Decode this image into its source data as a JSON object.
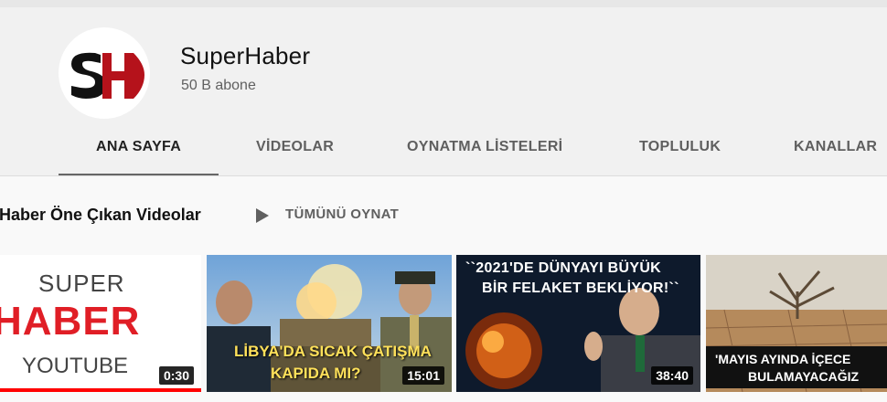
{
  "channel": {
    "name": "SuperHaber",
    "subscribers": "50 B abone",
    "avatar_letters": "SH",
    "brand_red": "#b5121b",
    "brand_black": "#111111"
  },
  "tabs": [
    {
      "label": "ANA SAYFA",
      "active": true
    },
    {
      "label": "VİDEOLAR",
      "active": false
    },
    {
      "label": "OYNATMA LİSTELERİ",
      "active": false
    },
    {
      "label": "TOPLULUK",
      "active": false
    },
    {
      "label": "KANALLAR",
      "active": false
    }
  ],
  "section": {
    "title": "rHaber Öne Çıkan Videolar",
    "play_all_label": "TÜMÜNÜ OYNAT",
    "play_icon": "play-icon"
  },
  "videos": [
    {
      "duration": "0:30",
      "thumb_lines": [
        "SUPER",
        "HABER",
        "YOUTUBE"
      ],
      "watched_fraction": 1.0
    },
    {
      "duration": "15:01",
      "thumb_lines": [
        "LİBYA'DA SICAK ÇATIŞMA",
        "KAPIDA MI?"
      ]
    },
    {
      "duration": "38:40",
      "thumb_lines": [
        "``2021'DE DÜNYAYI BÜYÜK",
        "BİR FELAKET BEKLİYOR!``"
      ]
    },
    {
      "duration": "",
      "thumb_lines": [
        "'MAYIS AYINDA İÇECE",
        "BULAMAYACAĞIZ"
      ]
    }
  ],
  "colors": {
    "page_bg": "#f1f1f1",
    "section_bg": "#f9f9f9",
    "accent_red": "#e01e26",
    "caption_yellow": "#ffe15a"
  }
}
